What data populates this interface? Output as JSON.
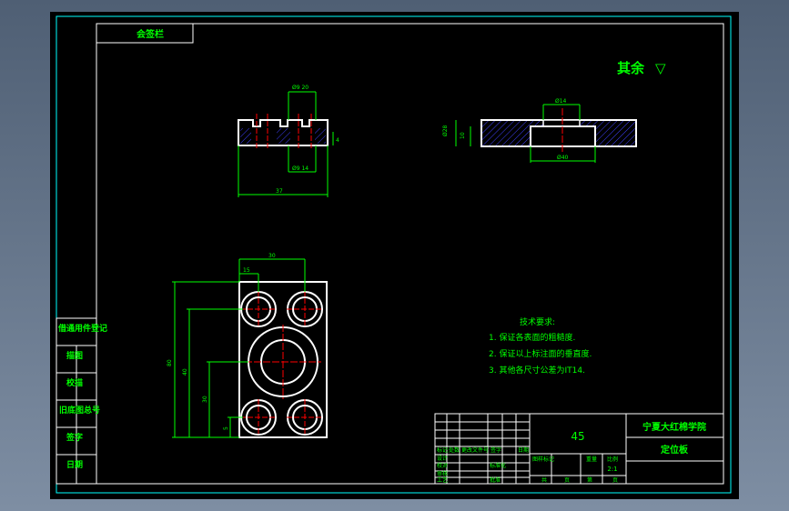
{
  "title_tab": "会签栏",
  "roughness": {
    "text": "其余",
    "symbol": "▽"
  },
  "side_labels": [
    "借通用件登记",
    "描图",
    "校描",
    "旧底图总号",
    "签字",
    "日期"
  ],
  "dims": {
    "top_view": {
      "top_hole": "Ø9  20",
      "bottom_hole": "Ø9  14",
      "depth": "4",
      "width": "37"
    },
    "section_view": {
      "hole_small": "Ø14",
      "hole_large": "Ø40",
      "left1": "Ø28",
      "left2": "10"
    },
    "front_view": {
      "top_30": "30",
      "top_15": "15",
      "h_outer": "80",
      "h_40": "40",
      "h_30": "30",
      "h_5": "5"
    }
  },
  "tech": {
    "title": "技术要求:",
    "items": [
      "1. 保证各表面的粗糙度.",
      "2. 保证以上标注面的垂直度.",
      "3. 其他各尺寸公差为IT14."
    ]
  },
  "title_block": {
    "material": "45",
    "school": "宁夏大红棉学院",
    "part_name": "定位板",
    "scale": "2:1",
    "row_labels": [
      "标记",
      "处数",
      "更改文件号",
      "签字",
      "日期"
    ],
    "col_labels": [
      "图样标记",
      "重量",
      "比例"
    ],
    "roles": [
      "设计",
      "校对",
      "审核",
      "工艺",
      "标准化",
      "批准"
    ],
    "sheet": [
      "共",
      "页",
      "第",
      "页"
    ]
  },
  "colors": {
    "frame": "#ffffff",
    "border": "#00ffff",
    "dim": "#00ff00",
    "text": "#00ff00",
    "center": "#ff0000",
    "hatch": "#4040ff",
    "background": "#000000"
  }
}
